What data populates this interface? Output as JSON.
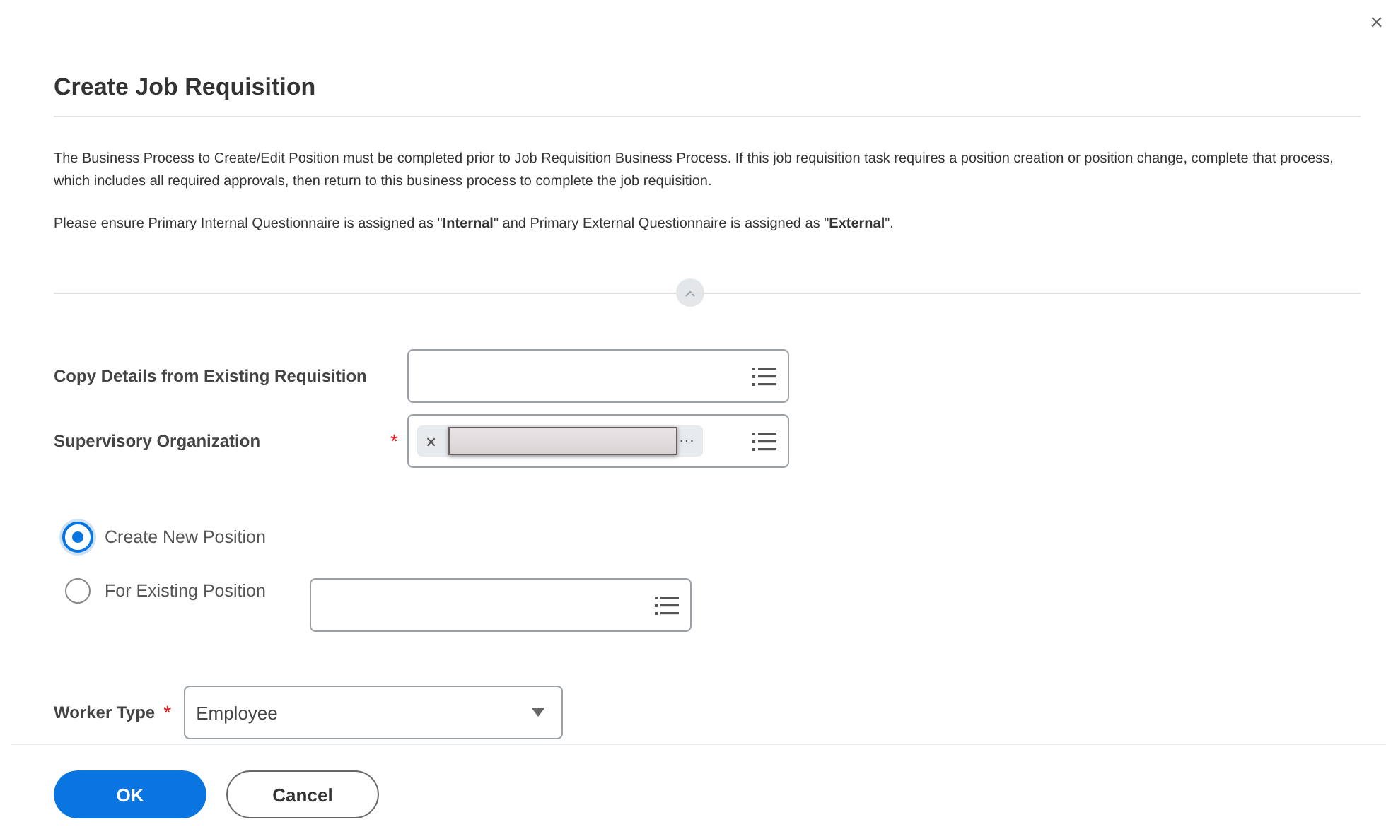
{
  "dialog": {
    "title": "Create Job Requisition",
    "close": "×"
  },
  "instructions": [
    "The Business Process to Create/Edit Position must be completed prior to Job Requisition Business Process. If this job requisition task requires a position creation or position change, complete that process, which includes all required approvals, then return to this business process to complete the job requisition.",
    "Please ensure Primary Internal Questionnaire is assigned as \"**Internal**\" and Primary External Questionnaire is assigned as \"**External**\"."
  ],
  "section": {
    "expanded": true
  },
  "fields": [
    {
      "label": "Copy Details from Existing Requisition"
    },
    {
      "label": "Supervisory Organization",
      "required_mark": "*",
      "chip": {
        "remove": "×",
        "more": "···"
      }
    }
  ],
  "position_options": [
    {
      "label": "Create New Position",
      "selected": true
    },
    {
      "label": "For Existing Position",
      "selected": false
    }
  ],
  "worker_type": {
    "label": "Worker Type",
    "required_mark": "*",
    "value": "Employee"
  },
  "buttons": [
    {
      "label": "OK",
      "kind": "primary"
    },
    {
      "label": "Cancel",
      "kind": "secondary"
    }
  ]
}
